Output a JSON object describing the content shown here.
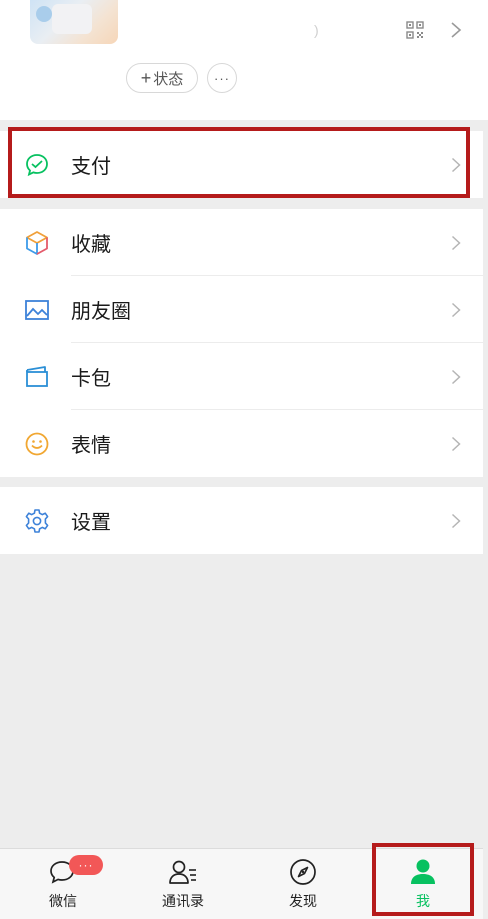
{
  "profile": {
    "status_button_plus": "+",
    "status_button_label": "状态",
    "more_button_label": "···",
    "moon_glyph": ")"
  },
  "menu": {
    "pay": {
      "label": "支付",
      "icon": "wechat-pay-icon",
      "color": "#07c160"
    },
    "sections": [
      {
        "items": [
          {
            "label": "收藏",
            "icon": "favorites-cube-icon"
          },
          {
            "label": "朋友圈",
            "icon": "moments-image-icon"
          },
          {
            "label": "卡包",
            "icon": "card-wallet-icon"
          },
          {
            "label": "表情",
            "icon": "smiley-icon"
          }
        ]
      },
      {
        "items": [
          {
            "label": "设置",
            "icon": "gear-icon"
          }
        ]
      }
    ]
  },
  "tabbar": {
    "tabs": [
      {
        "label": "微信",
        "icon": "chat-bubble-icon",
        "badge": "···"
      },
      {
        "label": "通讯录",
        "icon": "contacts-icon"
      },
      {
        "label": "发现",
        "icon": "compass-icon"
      },
      {
        "label": "我",
        "icon": "person-icon",
        "active": true
      }
    ],
    "active_color": "#07c160"
  },
  "highlight_color": "#b51b1b"
}
